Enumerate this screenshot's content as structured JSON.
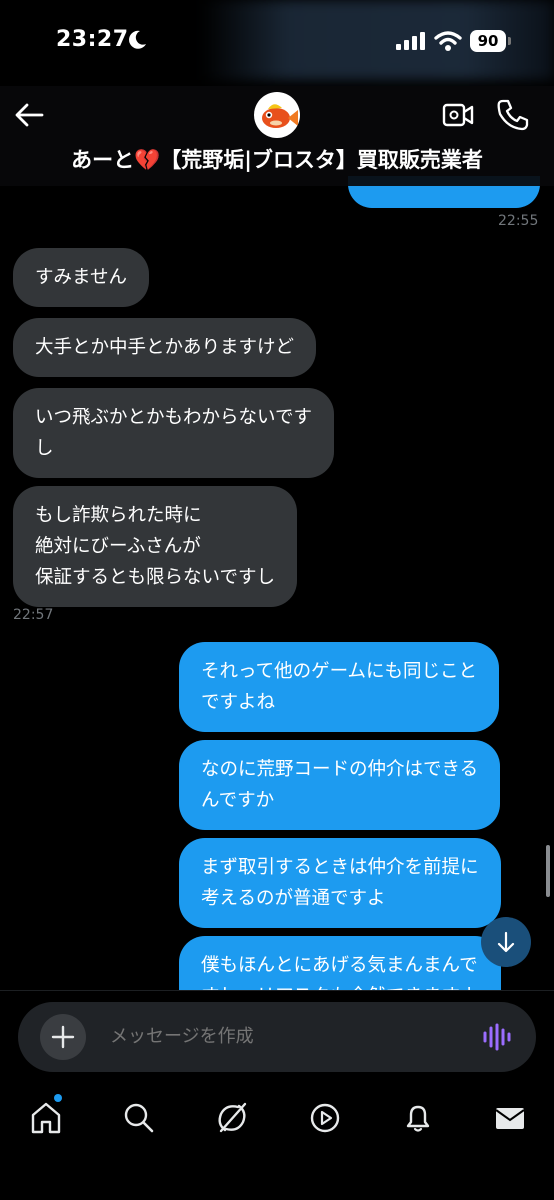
{
  "status_bar": {
    "time": "23:27",
    "battery": "90"
  },
  "header": {
    "title": "あーと💔【荒野垢|ブロスタ】買取販売業者"
  },
  "messages": [
    {
      "dir": "in",
      "text": "すみません"
    },
    {
      "dir": "in",
      "text": "大手とか中手とかありますけど"
    },
    {
      "dir": "in",
      "lines": [
        "いつ飛ぶかとかもわからないです",
        "し"
      ]
    },
    {
      "dir": "in",
      "lines": [
        "もし詐欺られた時に",
        "絶対にびーふさんが",
        "保証するとも限らないですし"
      ]
    },
    {
      "dir": "out",
      "lines": [
        "それって他のゲームにも同じこと",
        "ですよね"
      ]
    },
    {
      "dir": "out",
      "lines": [
        "なのに荒野コードの仲介はできる",
        "んですか"
      ]
    },
    {
      "dir": "out",
      "lines": [
        "まず取引するときは仲介を前提に",
        "考えるのが普通ですよ"
      ]
    },
    {
      "dir": "out",
      "lines": [
        "僕もほんとにあげる気まんまんで",
        "すし、リアスクも全然できますよ"
      ]
    }
  ],
  "timestamps": {
    "first": "22:55",
    "second": "22:57"
  },
  "composer": {
    "placeholder": "メッセージを作成"
  },
  "nav": [
    "home-icon",
    "search-icon",
    "grok-icon",
    "video-icon",
    "notifications-icon",
    "messages-icon"
  ],
  "colors": {
    "accent": "#1d9bf0",
    "incoming_bubble": "#333639",
    "voice_accent": "#9b6dff"
  }
}
